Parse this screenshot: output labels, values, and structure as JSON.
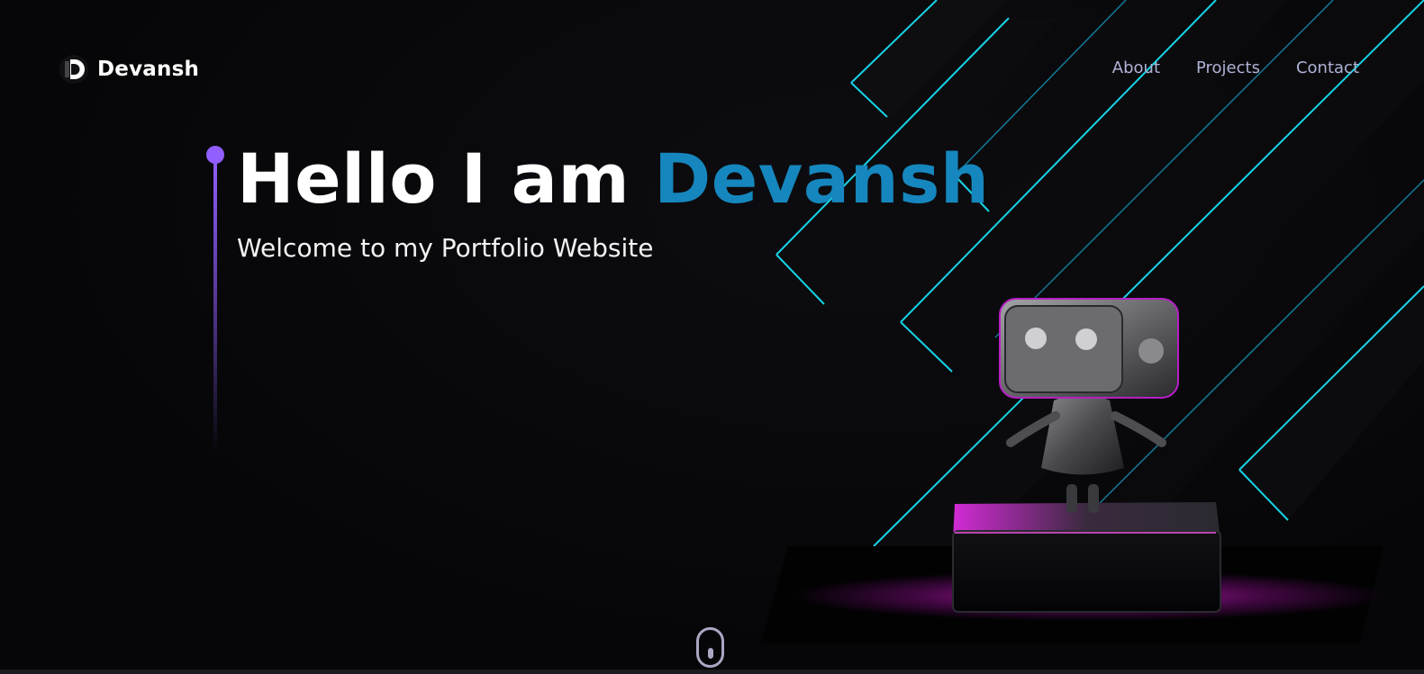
{
  "brand": {
    "name": "Devansh"
  },
  "nav": {
    "links": [
      "About",
      "Projects",
      "Contact"
    ]
  },
  "hero": {
    "greeting": "Hello I am ",
    "name": "Devansh",
    "subtitle": "Welcome to my Portfolio Website"
  },
  "colors": {
    "background": "#060608",
    "accent_blue": "#1687be",
    "accent_purple": "#915eff",
    "nav_text": "#aeb3d4",
    "neon_cyan": "#17d3e6",
    "neon_magenta": "#e31ce6"
  },
  "icons": {
    "logo": "logo-icon",
    "scroll": "mouse-scroll-icon"
  }
}
